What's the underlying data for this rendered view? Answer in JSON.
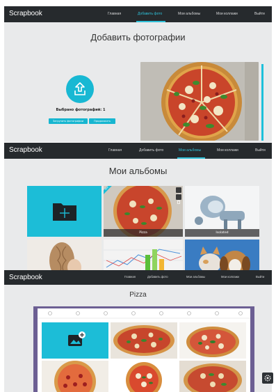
{
  "brand": "Scrapbook",
  "nav": {
    "home": "Главная",
    "add_photo": "Добавить фото",
    "my_albums": "Мои альбомы",
    "my_collages": "Мои коллажи",
    "logout": "Выйти"
  },
  "upload": {
    "title": "Добавить фотографии",
    "selected": "Выбрано фотографий: 1",
    "btn_upload": "Загрузить фотографии",
    "btn_next": "Продолжить"
  },
  "albums": {
    "title": "Мои альбомы",
    "new_ribbon": "NEW",
    "tiles": [
      {
        "label": ""
      },
      {
        "label": "Pizza"
      },
      {
        "label": "Isolated"
      }
    ]
  },
  "album_view": {
    "title": "Pizza"
  },
  "colors": {
    "accent": "#1cbdd7",
    "nav_bg": "#262a2d",
    "book_border": "#6c5f93"
  },
  "icons": [
    "upload-icon",
    "folder-plus-icon",
    "edit-icon",
    "delete-icon",
    "add-image-icon",
    "gear-icon"
  ]
}
